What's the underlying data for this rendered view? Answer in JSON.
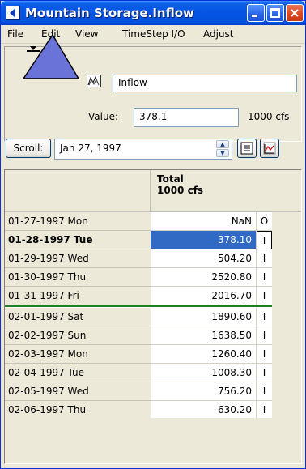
{
  "window": {
    "title": "Mountain Storage.Inflow",
    "controls": [
      "minimize",
      "maximize",
      "close"
    ]
  },
  "menu": [
    "File",
    "Edit",
    "View",
    "TimeStep I/O",
    "Adjust"
  ],
  "slot": {
    "name": "Inflow",
    "value_label": "Value:",
    "value": "378.1",
    "units": "1000 cfs"
  },
  "scroll": {
    "button_label": "Scroll:",
    "date": "Jan 27, 1997"
  },
  "table": {
    "column_header_line1": "Total",
    "column_header_line2": "1000 cfs",
    "rows": [
      {
        "date": "01-27-1997 Mon",
        "value": "NaN",
        "flag": "O"
      },
      {
        "date": "01-28-1997 Tue",
        "value": "378.10",
        "flag": "I"
      },
      {
        "date": "01-29-1997 Wed",
        "value": "504.20",
        "flag": "I"
      },
      {
        "date": "01-30-1997 Thu",
        "value": "2520.80",
        "flag": "I"
      },
      {
        "date": "01-31-1997 Fri",
        "value": "2016.70",
        "flag": "I"
      },
      {
        "date": "02-01-1997 Sat",
        "value": "1890.60",
        "flag": "I"
      },
      {
        "date": "02-02-1997 Sun",
        "value": "1638.50",
        "flag": "I"
      },
      {
        "date": "02-03-1997 Mon",
        "value": "1260.40",
        "flag": "I"
      },
      {
        "date": "02-04-1997 Tue",
        "value": "1008.30",
        "flag": "I"
      },
      {
        "date": "02-05-1997 Wed",
        "value": "756.20",
        "flag": "I"
      },
      {
        "date": "02-06-1997 Thu",
        "value": "630.20",
        "flag": "I"
      }
    ],
    "selected_row": 1
  },
  "colors": {
    "titlebar": "#0554E3",
    "selection": "#316AC5",
    "reservoir": "#6A73D8",
    "separator": "#208020"
  }
}
